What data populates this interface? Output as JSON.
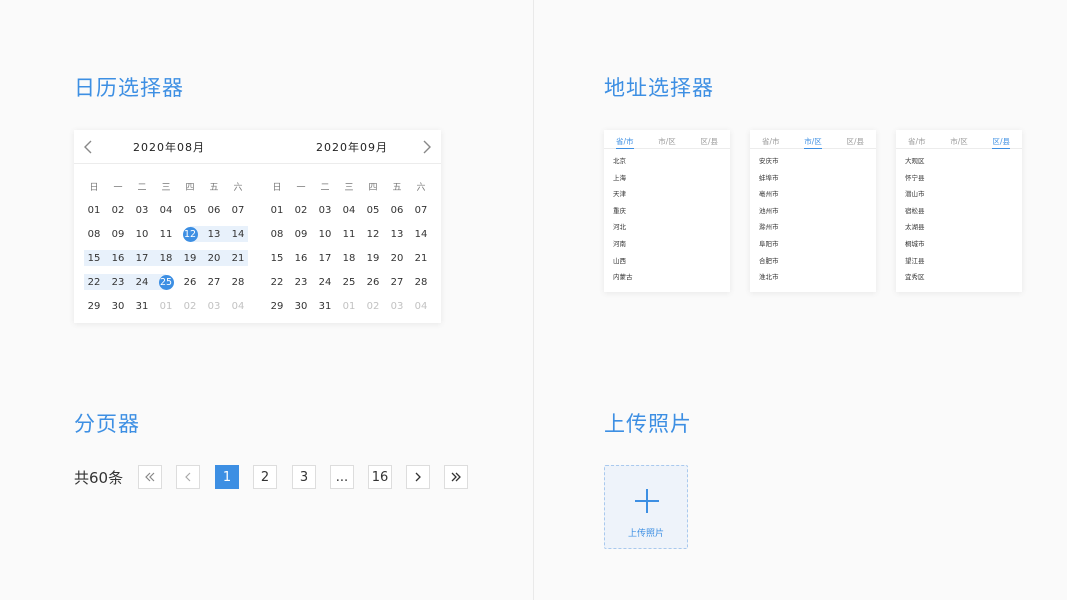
{
  "sections": {
    "calendar_title": "日历选择器",
    "address_title": "地址选择器",
    "pagination_title": "分页器",
    "upload_title": "上传照片"
  },
  "calendar": {
    "weekdays": [
      "日",
      "一",
      "二",
      "三",
      "四",
      "五",
      "六"
    ],
    "left_month": {
      "title": "2020年08月",
      "rows": [
        [
          "01",
          "02",
          "03",
          "04",
          "05",
          "06",
          "07"
        ],
        [
          "08",
          "09",
          "10",
          "11",
          "12",
          "13",
          "14"
        ],
        [
          "15",
          "16",
          "17",
          "18",
          "19",
          "20",
          "21"
        ],
        [
          "22",
          "23",
          "24",
          "25",
          "26",
          "27",
          "28"
        ],
        [
          "29",
          "30",
          "31",
          "01",
          "02",
          "03",
          "04"
        ]
      ]
    },
    "right_month": {
      "title": "2020年09月",
      "rows": [
        [
          "01",
          "02",
          "03",
          "04",
          "05",
          "06",
          "07"
        ],
        [
          "08",
          "09",
          "10",
          "11",
          "12",
          "13",
          "14"
        ],
        [
          "15",
          "16",
          "17",
          "18",
          "19",
          "20",
          "21"
        ],
        [
          "22",
          "23",
          "24",
          "25",
          "26",
          "27",
          "28"
        ],
        [
          "29",
          "30",
          "31",
          "01",
          "02",
          "03",
          "04"
        ]
      ]
    },
    "range_start": "12",
    "range_end": "25",
    "accent_color": "#3d8fe3",
    "range_color": "#e8f1fb"
  },
  "address": {
    "tabs": [
      "省/市",
      "市/区",
      "区/县"
    ],
    "panels": [
      {
        "active_tab": 0,
        "items": [
          "北京",
          "上海",
          "天津",
          "重庆",
          "河北",
          "河南",
          "山西",
          "内蒙古"
        ]
      },
      {
        "active_tab": 1,
        "items": [
          "安庆市",
          "蚌埠市",
          "亳州市",
          "池州市",
          "滁州市",
          "阜阳市",
          "合肥市",
          "淮北市"
        ]
      },
      {
        "active_tab": 2,
        "items": [
          "大观区",
          "怀宁县",
          "潜山市",
          "宿松县",
          "太湖县",
          "桐城市",
          "望江县",
          "宜秀区"
        ]
      }
    ]
  },
  "pagination": {
    "total_label": "共60条",
    "first_icon": "double-chevron-left-icon",
    "prev_icon": "chevron-left-icon",
    "pages": [
      "1",
      "2",
      "3",
      "...",
      "16"
    ],
    "active_page": "1",
    "next_icon": "chevron-right-icon",
    "last_icon": "double-chevron-right-icon"
  },
  "upload": {
    "icon": "plus-icon",
    "label": "上传照片"
  }
}
